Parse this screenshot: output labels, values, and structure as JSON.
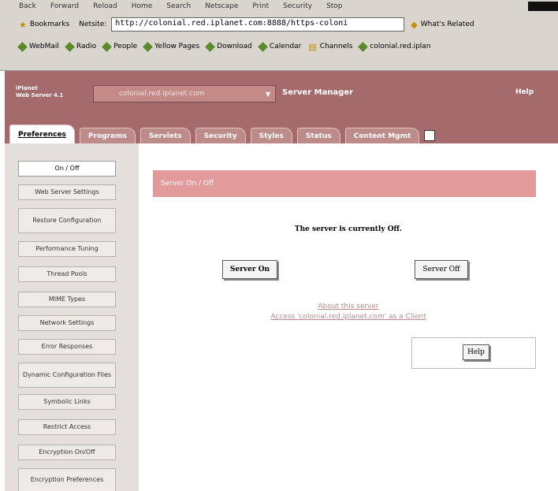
{
  "browser": {
    "menu": [
      "Back",
      "Forward",
      "Reload",
      "Home",
      "Search",
      "Netscape",
      "Print",
      "Security",
      "Stop"
    ],
    "bookmarks_label": "Bookmarks",
    "location_label": "Netsite:",
    "url": "http://colonial.red.iplanet.com:8888/https-coloni",
    "related_label": "What's Related",
    "personal_toolbar": [
      "WebMail",
      "Radio",
      "People",
      "Yellow Pages",
      "Download",
      "Calendar",
      "Channels",
      "colonial.red.iplan"
    ]
  },
  "header": {
    "brand_line1": "iPlanet",
    "brand_line2": "Web Server 4.1",
    "server_select_value": "colonial.red.iplanet.com",
    "title": "Server Manager",
    "help": "Help",
    "tabs": [
      "Preferences",
      "Programs",
      "Servlets",
      "Security",
      "Styles",
      "Status",
      "Content Mgmt"
    ]
  },
  "sidebar": {
    "items": [
      "On / Off",
      "Web Server Settings",
      "Restore Configuration",
      "Performance Tuning",
      "Thread Pools",
      "MIME Types",
      "Network Settings",
      "Error Responses",
      "Dynamic Configuration Files",
      "Symbolic Links",
      "Restrict Access",
      "Encryption On/Off",
      "Encryption Preferences"
    ]
  },
  "main": {
    "section_title": "Server On / Off",
    "status_text": "The server is currently Off.",
    "server_on_button": "Server On",
    "server_off_button": "Server Off",
    "about_link": "About this server",
    "client_link": "Access 'colonial.red.iplanet.com' as a Client",
    "help_button": "Help"
  },
  "colors": {
    "header_bg": "#a56b6c",
    "section_bar": "#e29a9a",
    "link": "#b58b8b",
    "sidebar_bg": "#e4dfdb"
  }
}
